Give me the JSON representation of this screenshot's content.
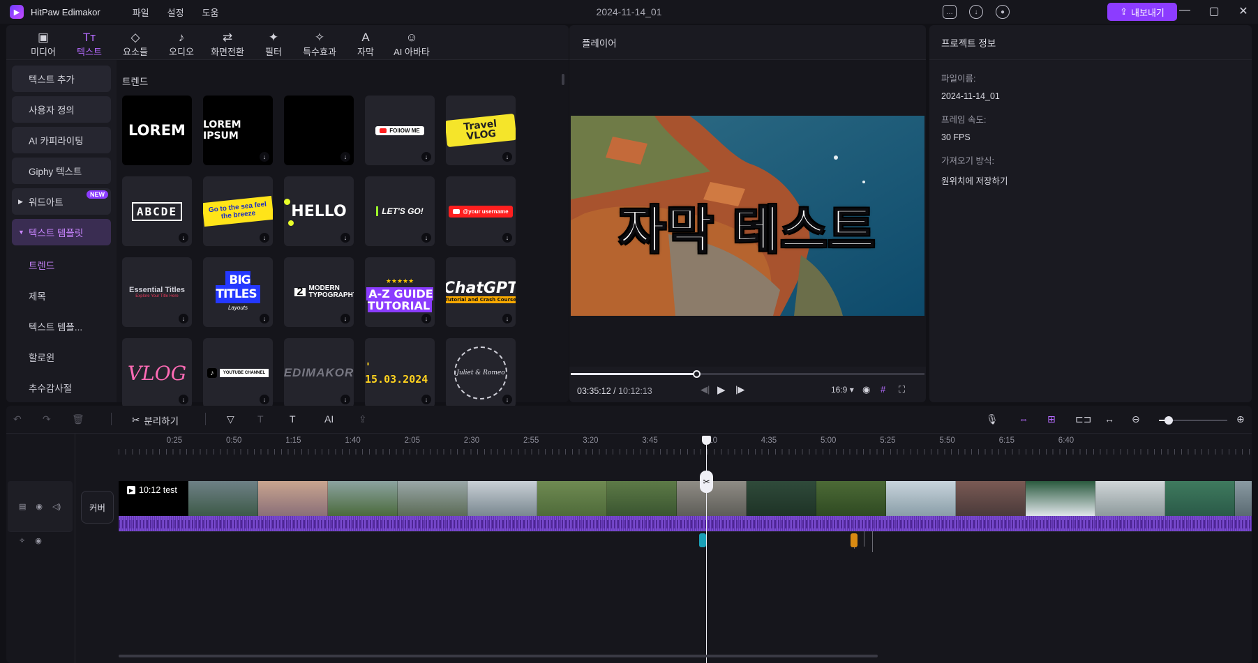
{
  "app": {
    "name": "HitPaw Edimakor",
    "menu": [
      "파일",
      "설정",
      "도움"
    ],
    "doc_title": "2024-11-14_01",
    "export_label": "내보내기",
    "accent": "#8c3cff"
  },
  "toolbar": {
    "tabs": [
      {
        "label": "미디어",
        "icon": "media-icon"
      },
      {
        "label": "텍스트",
        "icon": "text-icon",
        "active": true
      },
      {
        "label": "요소들",
        "icon": "elements-icon"
      },
      {
        "label": "오디오",
        "icon": "audio-icon"
      },
      {
        "label": "화면전환",
        "icon": "transition-icon"
      },
      {
        "label": "필터",
        "icon": "filter-icon"
      },
      {
        "label": "특수효과",
        "icon": "effects-icon"
      },
      {
        "label": "자막",
        "icon": "subtitle-icon"
      },
      {
        "label": "AI 아바타",
        "icon": "avatar-icon"
      }
    ]
  },
  "sidebar": {
    "buttons": [
      "텍스트 추가",
      "사용자 정의",
      "AI 카피라이팅",
      "Giphy 텍스트"
    ],
    "wordart": {
      "label": "워드아트",
      "badge": "NEW"
    },
    "template": {
      "label": "텍스트 템플릿"
    },
    "sub_items": [
      "트렌드",
      "제목",
      "텍스트 템플...",
      "할로윈",
      "추수감사절"
    ]
  },
  "templates": {
    "section_label": "트렌드",
    "cards": [
      {
        "text": "LOREM"
      },
      {
        "text": "LOREM IPSUM"
      },
      {
        "text": ""
      },
      {
        "text": "FOllOW ME"
      },
      {
        "text": "Travel VLOG"
      },
      {
        "text": "ABCDE"
      },
      {
        "text": "Go to the sea feel the breeze"
      },
      {
        "text": "HELLO"
      },
      {
        "text": "LET'S GO!"
      },
      {
        "text": "@your username"
      },
      {
        "text": "Essential Titles",
        "sub": "Explore Your Title Here"
      },
      {
        "text": "BIG TITLES",
        "sub": "Layouts"
      },
      {
        "text": "MODERN TYPOGRAPHY",
        "num": "2"
      },
      {
        "text": "A-Z GUIDE TUTORIAL",
        "stars": "★★★★★"
      },
      {
        "text": "ChatGPT",
        "sub": "Tutorial and Crash Course"
      },
      {
        "text": "VLOG"
      },
      {
        "text": "YOUTUBE CHANNEL"
      },
      {
        "text": "EDIMAKOR"
      },
      {
        "text": "' 15.03.2024"
      },
      {
        "text": "Juliet & Romeo"
      }
    ]
  },
  "player": {
    "title": "플레이어",
    "subtitle_text": "자막 테스트",
    "current_time": "03:35:12",
    "total_time": "10:12:13",
    "progress": 0.355,
    "aspect_ratio": "16:9"
  },
  "project_info": {
    "title": "프로젝트 정보",
    "filename_label": "파일이름:",
    "filename": "2024-11-14_01",
    "fps_label": "프레임 속도:",
    "fps": "30 FPS",
    "import_label": "가져오기 방식:",
    "import_mode": "원위치에 저장하기"
  },
  "timeline": {
    "split_label": "분리하기",
    "ruler": [
      "0:25",
      "0:50",
      "1:15",
      "1:40",
      "2:05",
      "2:30",
      "2:55",
      "3:20",
      "3:45",
      "4:10",
      "4:35",
      "5:00",
      "5:25",
      "5:50",
      "6:15",
      "6:40"
    ],
    "cover_label": "커버",
    "clip_title": "10:12 test",
    "zoom_level": 0.14,
    "colors": {
      "audio": "#7a4bd0",
      "keyframe_teal": "#1aa0b8",
      "keyframe_orange": "#d98a12"
    }
  }
}
